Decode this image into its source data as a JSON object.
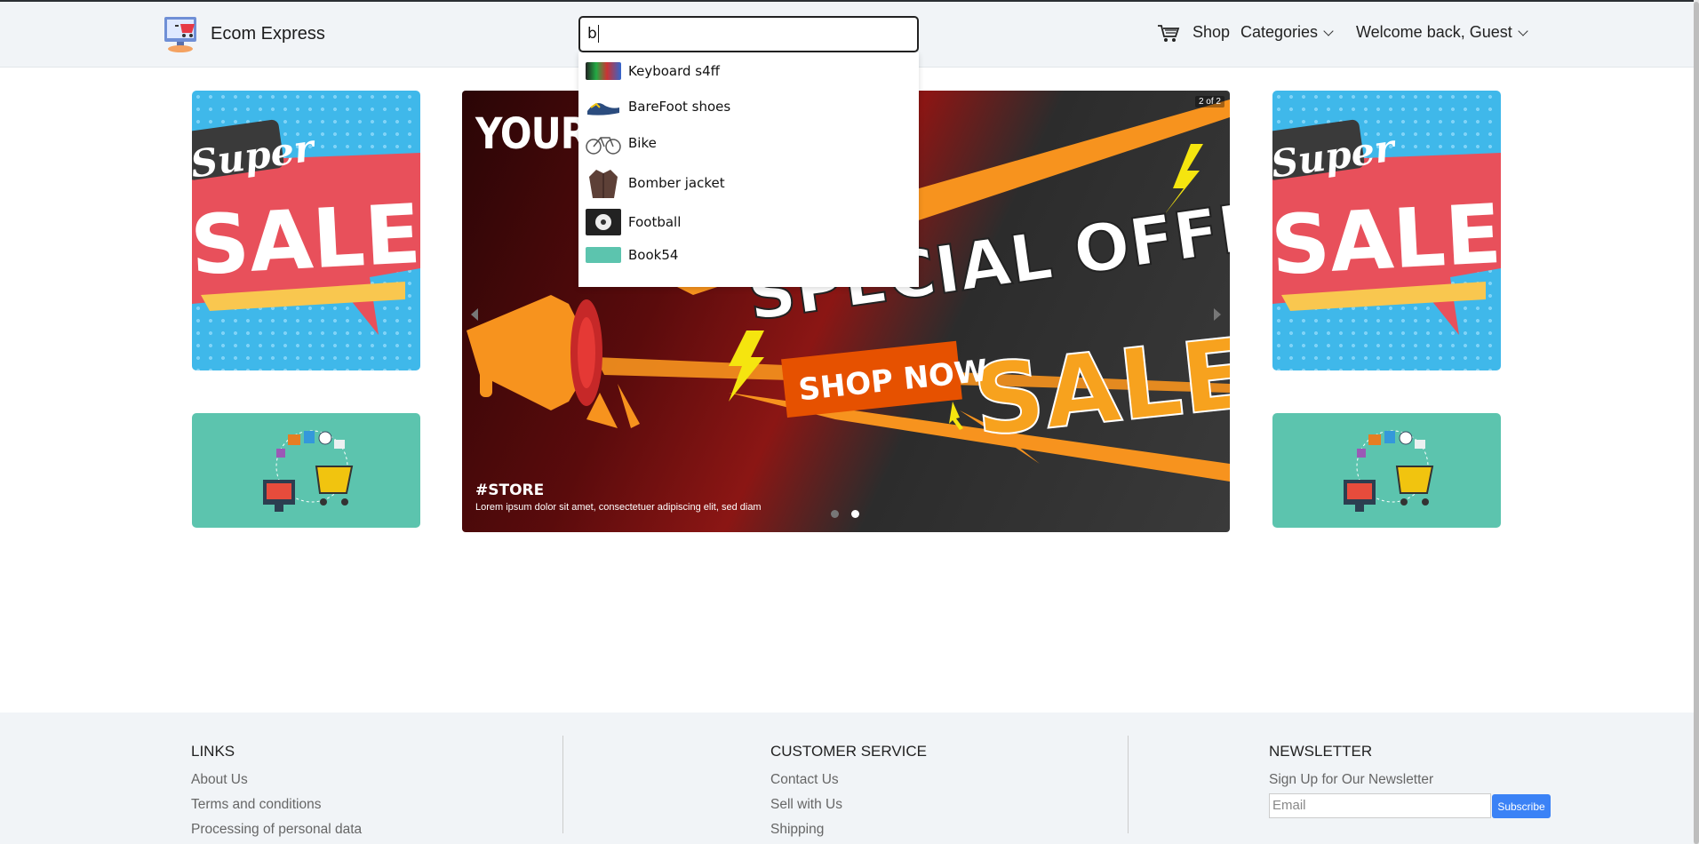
{
  "header": {
    "brand": "Ecom Express",
    "search_value": "b",
    "nav": {
      "shop": "Shop",
      "categories": "Categories",
      "welcome": "Welcome back, Guest"
    }
  },
  "search_suggestions": [
    {
      "label": "Keyboard s4ff",
      "icon": "keyboard-thumbnail"
    },
    {
      "label": "BareFoot shoes",
      "icon": "shoes-thumbnail"
    },
    {
      "label": "Bike",
      "icon": "bike-thumbnail"
    },
    {
      "label": "Bomber jacket",
      "icon": "jacket-thumbnail"
    },
    {
      "label": "Football",
      "icon": "football-thumbnail"
    },
    {
      "label": "Book54",
      "icon": "book-thumbnail"
    }
  ],
  "promo": {
    "sale_text_top": "Super",
    "sale_text_main": "SALE"
  },
  "carousel": {
    "counter": "2 of 2",
    "hero_title": "YOUR LO",
    "banner_line1": "SPECIAL OFFER",
    "banner_line2": "SALE",
    "button": "SHOP NOW",
    "caption_title": "#STORE",
    "caption_text": "Lorem ipsum dolor sit amet, consectetuer adipiscing elit, sed diam",
    "current_slide": 2,
    "total_slides": 2
  },
  "footer": {
    "links": {
      "title": "LINKS",
      "items": [
        "About Us",
        "Terms and conditions",
        "Processing of personal data"
      ]
    },
    "customer_service": {
      "title": "CUSTOMER SERVICE",
      "items": [
        "Contact Us",
        "Sell with Us",
        "Shipping"
      ]
    },
    "newsletter": {
      "title": "NEWSLETTER",
      "subtitle": "Sign Up for Our Newsletter",
      "email_placeholder": "Email",
      "button": "Subscribe"
    }
  },
  "colors": {
    "header_bg": "#f1f4f7",
    "sale_blue": "#3fb8ea",
    "sale_red": "#e8505b",
    "teal": "#5cc4ae",
    "orange": "#f7931e",
    "subscribe_blue": "#3b82f6"
  }
}
